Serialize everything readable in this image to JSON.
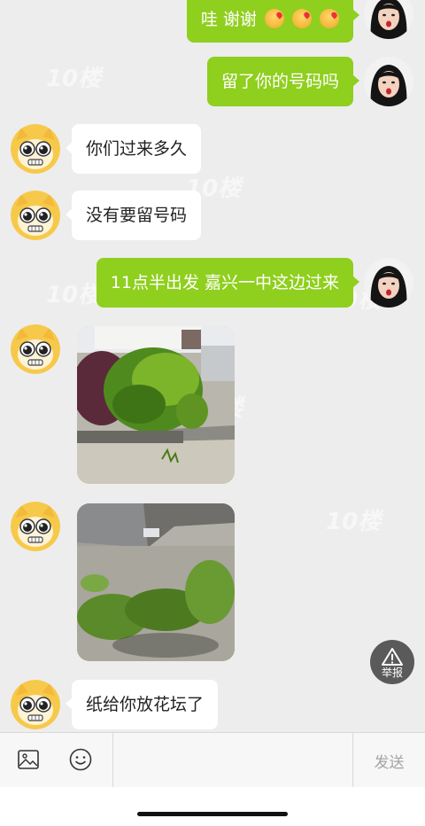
{
  "messages": [
    {
      "id": "m1",
      "side": "out",
      "text": "哇 谢谢",
      "emojis": [
        "kiss-emoji",
        "kiss-emoji",
        "kiss-emoji"
      ]
    },
    {
      "id": "m2",
      "side": "out",
      "text": "留了你的号码吗"
    },
    {
      "id": "m3",
      "side": "in",
      "text": "你们过来多久"
    },
    {
      "id": "m4",
      "side": "in",
      "text": "没有要留号码"
    },
    {
      "id": "m5",
      "side": "out",
      "text": "11点半出发 嘉兴一中这边过来"
    },
    {
      "id": "m6",
      "side": "in",
      "type": "image",
      "content": "photo-of-hedge-and-flower-bed"
    },
    {
      "id": "m7",
      "side": "in",
      "type": "image",
      "content": "photo-of-weeds-by-curb"
    },
    {
      "id": "m8",
      "side": "in",
      "text": "纸给你放花坛了"
    }
  ],
  "avatars": {
    "incoming": "cartoon-cat-avatar",
    "outgoing": "girl-avatar"
  },
  "watermark": "10楼",
  "report": {
    "label": "举报",
    "icon": "warning-triangle-icon"
  },
  "input_bar": {
    "image_icon": "image-icon",
    "emoji_icon": "smile-icon",
    "placeholder": "",
    "send_label": "发送"
  },
  "colors": {
    "outgoing_bubble": "#8fcf1e",
    "incoming_bubble": "#ffffff",
    "background": "#ededed",
    "report_bg": "#5a5a5a"
  }
}
